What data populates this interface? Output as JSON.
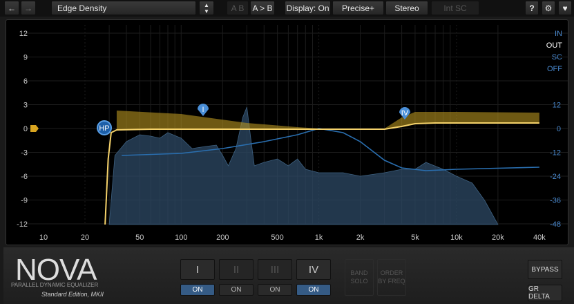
{
  "toolbar": {
    "back_icon": "arrow-left-icon",
    "forward_icon": "arrow-right-icon",
    "preset": "Edge Density",
    "ab": "A B",
    "a_to_b": "A > B",
    "display": "Display: On",
    "precise": "Precise+",
    "stereo": "Stereo",
    "int_sc": "Int SC",
    "help": "?",
    "settings_icon": "gear-icon",
    "heart_icon": "heart-icon"
  },
  "graph": {
    "left_axis": [
      "12",
      "9",
      "6",
      "3",
      "0",
      "-3",
      "-6",
      "-9",
      "-12"
    ],
    "right_axis": [
      "12",
      "0",
      "-12",
      "-24",
      "-36",
      "-48"
    ],
    "freq_axis": [
      "10",
      "20",
      "50",
      "100",
      "200",
      "500",
      "1k",
      "2k",
      "5k",
      "10k",
      "20k",
      "40k"
    ],
    "modes": [
      "IN",
      "OUT",
      "SC",
      "OFF"
    ],
    "active_mode": "OUT",
    "nodes": {
      "hp": "HP",
      "band1": "I",
      "band4": "IV"
    }
  },
  "brand": {
    "name": "NOVA",
    "subtitle": "PARALLEL DYNAMIC EQUALIZER",
    "edition": "Standard Edition, MKII"
  },
  "bands": [
    {
      "label": "I",
      "on": "ON",
      "active": true
    },
    {
      "label": "II",
      "on": "ON",
      "active": false
    },
    {
      "label": "III",
      "on": "ON",
      "active": false
    },
    {
      "label": "IV",
      "on": "ON",
      "active": true
    }
  ],
  "band_solo": "BAND SOLO",
  "order_by_freq": "ORDER BY FREQ",
  "bypass": "BYPASS",
  "gr_delta": "GR DELTA",
  "colors": {
    "eq_curve": "#f5d26a",
    "spectrum": "#2d4a66",
    "sc_curve": "#2a6fb0",
    "accent": "#355b85"
  }
}
